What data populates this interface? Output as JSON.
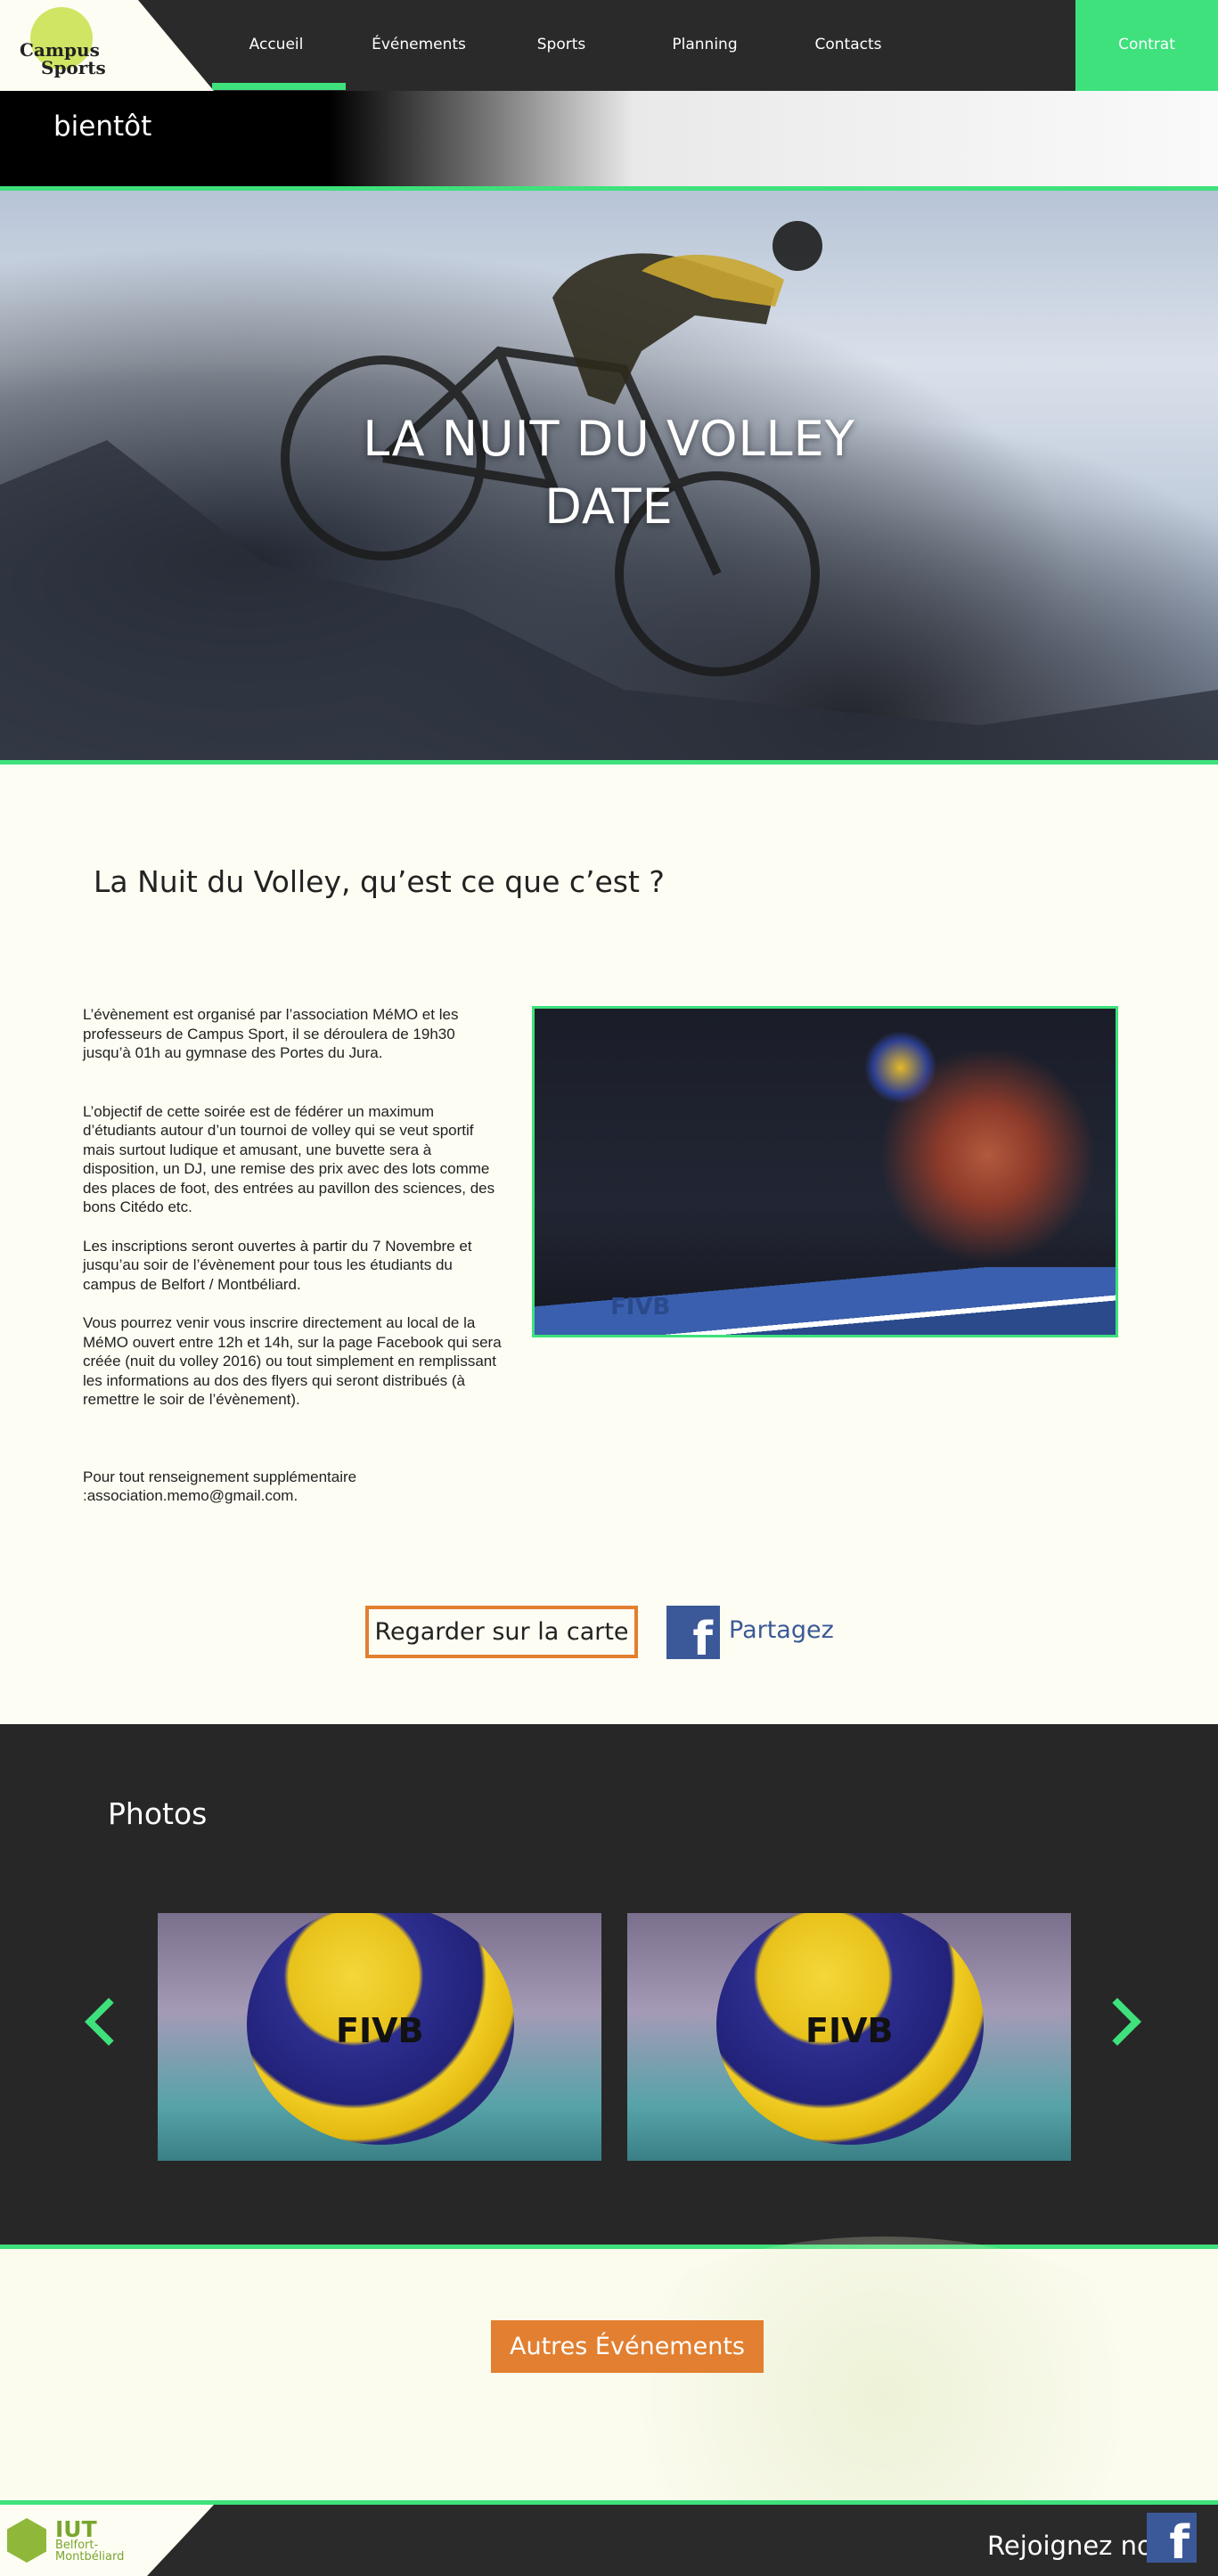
{
  "nav": {
    "logo": [
      "Campus",
      "Sports"
    ],
    "items": [
      "Accueil",
      "Événements",
      "Sports",
      "Planning",
      "Contacts"
    ],
    "contrat": "Contrat"
  },
  "banner": {
    "text": "bientôt"
  },
  "hero": {
    "title_line1": "LA NUIT DU VOLLEY",
    "title_line2": "DATE"
  },
  "content": {
    "title": "La Nuit du Volley, qu’est ce que c’est ?",
    "paragraphs": [
      "L’évènement est organisé par l’association MéMO et les professeurs de Campus Sport, il se déroulera de 19h30 jusqu’à 01h au gymnase des Portes du Jura.",
      "L’objectif de cette soirée est de fédérer un maximum d’étudiants autour d’un tournoi de volley qui se veut sportif mais surtout ludique et amusant, une buvette sera à disposition, un DJ, une remise des prix avec des lots comme des places de foot, des entrées au pavillon des sciences, des bons Citédo etc.",
      "Les inscriptions seront ouvertes à partir du 7 Novembre et jusqu’au soir de l’évènement pour tous les étudiants du campus de Belfort / Montbéliard.",
      "Vous pourrez venir vous inscrire directement au local de la MéMO ouvert entre 12h et 14h, sur la page Facebook qui sera créée (nuit du volley 2016) ou tout simplement en remplissant les informations au dos des flyers qui seront distribués (à remettre le soir de l’évènement).",
      "Pour tout renseignement supplémentaire :association.memo@gmail.com."
    ],
    "photo_label": "FIVB",
    "map_button": "Regarder sur la carte",
    "share_label": "Partagez"
  },
  "photos": {
    "title": "Photos",
    "ball_label": "FIVB"
  },
  "autres_button": "Autres Événements",
  "footer": {
    "iut_title": "IUT",
    "iut_sub": [
      "Belfort-",
      "Montbéliard"
    ],
    "rejoignez": "Rejoignez nous"
  },
  "colors": {
    "accent": "#3ee17c",
    "orange": "#e27f30",
    "facebook": "#3b5998",
    "dark": "#2a2a2a"
  }
}
